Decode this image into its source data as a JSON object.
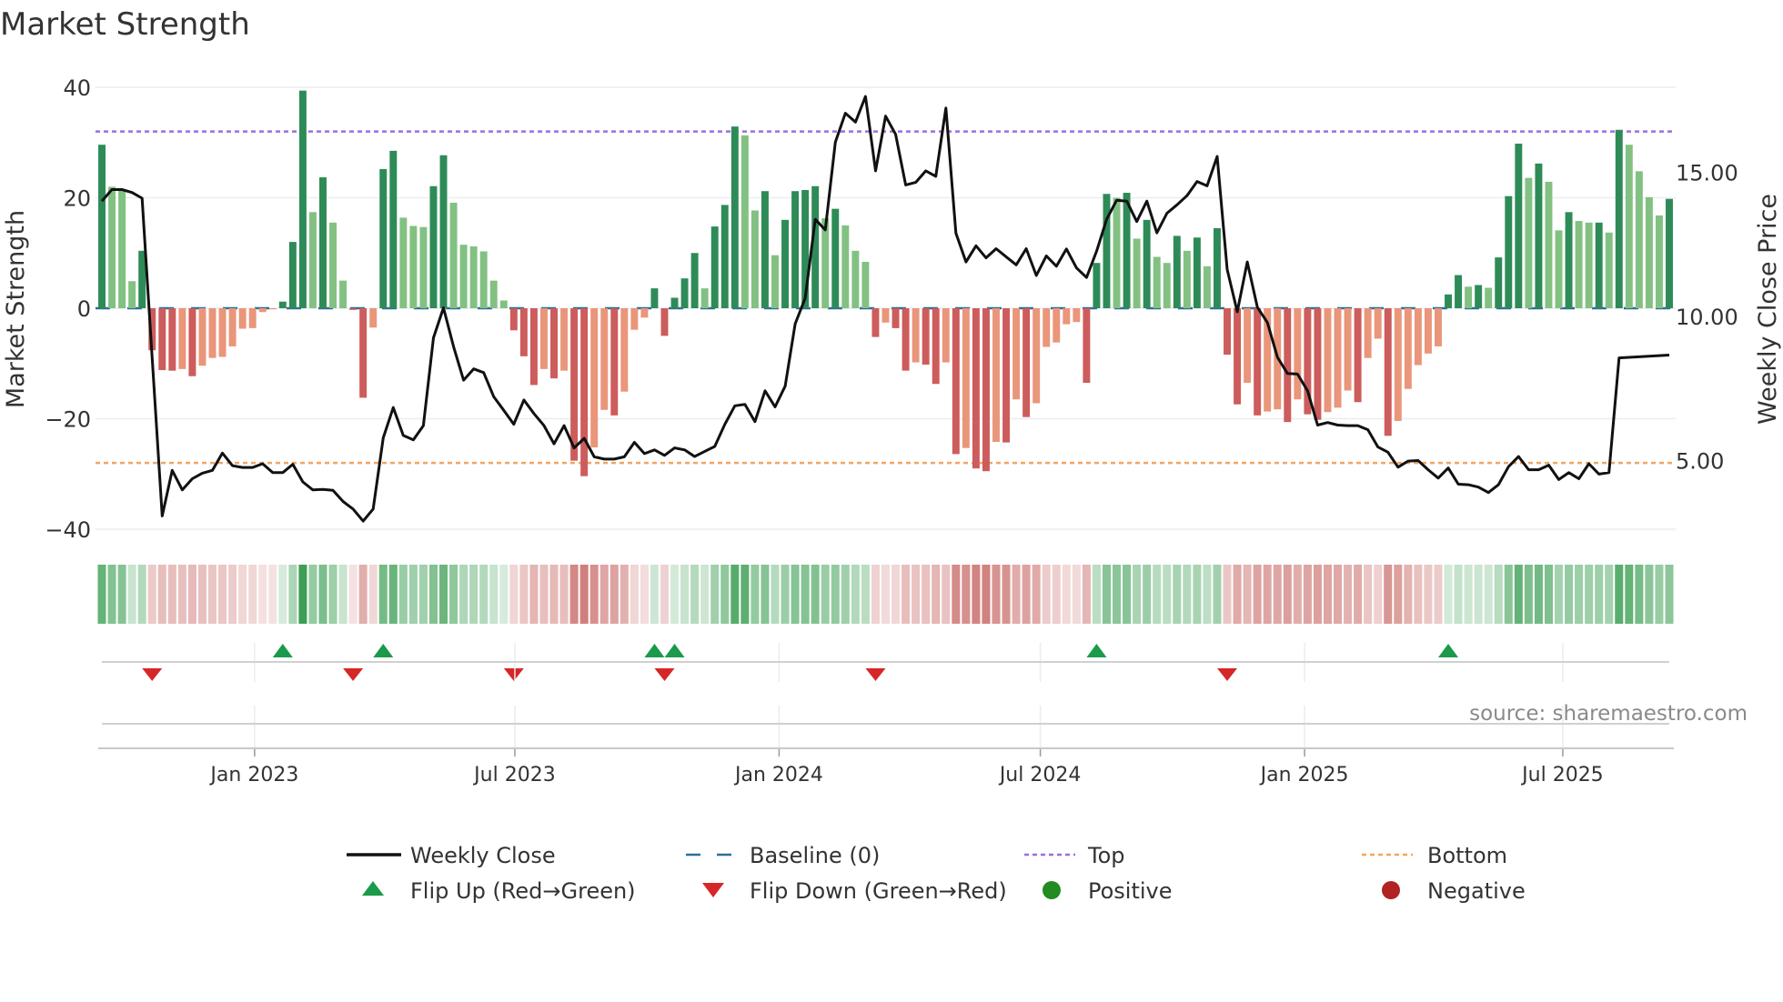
{
  "chart_data": {
    "type": "bar",
    "title": "Market Strength",
    "ylabel": "Market Strength",
    "y2label": "Weekly Close Price",
    "source": "source: sharemaestro.com",
    "ylim": [
      -42,
      42
    ],
    "yticks": [
      40,
      20,
      0,
      -20,
      -40
    ],
    "ytick_labels": [
      "40",
      "20",
      "0",
      "−20",
      "−40"
    ],
    "y2ticks": [
      5,
      10,
      15
    ],
    "y2tick_labels": [
      "5.00",
      "10.00",
      "15.00"
    ],
    "top_level": 32,
    "bottom_level": -28,
    "xticks": [
      {
        "week": 15.2,
        "label": "Jan 2023"
      },
      {
        "week": 41.1,
        "label": "Jul 2023"
      },
      {
        "week": 67.4,
        "label": "Jan 2024"
      },
      {
        "week": 93.4,
        "label": "Jul 2024"
      },
      {
        "week": 119.7,
        "label": "Jan 2025"
      },
      {
        "week": 145.4,
        "label": "Jul 2025"
      }
    ],
    "strength": [
      29.6,
      22,
      21.3,
      4.9,
      10.4,
      -7.6,
      -11.2,
      -11.3,
      -11,
      -12.3,
      -10.4,
      -9,
      -8.8,
      -6.9,
      -3.7,
      -3.6,
      -0.7,
      -0.2,
      1.2,
      12,
      39.4,
      17.4,
      23.7,
      15.5,
      5,
      -0.3,
      -16.2,
      -3.5,
      25.2,
      28.5,
      16.4,
      14.9,
      14.7,
      22.1,
      27.7,
      19.1,
      11.5,
      11.2,
      10.3,
      5,
      1.4,
      -4,
      -8.7,
      -13.9,
      -11,
      -12.7,
      -11.3,
      -27.6,
      -30.4,
      -25.2,
      -18.4,
      -19.4,
      -15.1,
      -3.9,
      -1.7,
      3.6,
      -5,
      1.9,
      5.4,
      10,
      3.6,
      14.8,
      18.7,
      32.9,
      31.3,
      17.7,
      21.2,
      9.6,
      16,
      21.2,
      21.4,
      22.1,
      16.3,
      18,
      15,
      10.4,
      8.4,
      -5.2,
      -2.6,
      -3.6,
      -11.3,
      -9.8,
      -10.2,
      -13.7,
      -9.8,
      -26.4,
      -25.3,
      -29,
      -29.5,
      -24.2,
      -24.3,
      -16.5,
      -19.7,
      -17.2,
      -7,
      -6.2,
      -2.9,
      -2.5,
      -13.5,
      8.2,
      20.7,
      20,
      20.9,
      12.6,
      16,
      9.3,
      8.2,
      13.1,
      10.4,
      12.8,
      7.6,
      14.5,
      -8.4,
      -17.4,
      -13.5,
      -19.4,
      -18.7,
      -18.3,
      -20.6,
      -16.5,
      -19.2,
      -20.2,
      -18.8,
      -18,
      -14.9,
      -17,
      -9,
      -5.5,
      -23.1,
      -20.4,
      -14.6,
      -10.3,
      -8.2,
      -6.9,
      2.5,
      6,
      3.9,
      4.2,
      3.7,
      9.2,
      20.3,
      29.8,
      23.6,
      26.2,
      22.9,
      14.1,
      17.4,
      15.8,
      15.5,
      15.5,
      13.7,
      32.3,
      29.6,
      24.8,
      20.1,
      16.8,
      19.8
    ],
    "weekly_close": [
      14.0,
      14.4,
      14.4,
      14.3,
      14.1,
      8.6,
      3.08,
      4.66,
      3.98,
      4.37,
      4.56,
      4.66,
      5.26,
      4.82,
      4.76,
      4.76,
      4.89,
      4.58,
      4.58,
      4.87,
      4.26,
      3.98,
      4.0,
      3.97,
      3.58,
      3.32,
      2.9,
      3.32,
      5.79,
      6.84,
      5.87,
      5.72,
      6.21,
      9.26,
      10.3,
      8.95,
      7.79,
      8.18,
      8.05,
      7.21,
      6.74,
      6.26,
      7.1,
      6.63,
      6.21,
      5.58,
      6.21,
      5.44,
      5.77,
      5.13,
      5.05,
      5.05,
      5.13,
      5.63,
      5.24,
      5.37,
      5.18,
      5.44,
      5.37,
      5.14,
      5.32,
      5.49,
      6.26,
      6.9,
      6.95,
      6.35,
      7.42,
      6.86,
      7.58,
      9.74,
      10.63,
      13.37,
      13.0,
      16.05,
      17.05,
      16.74,
      17.63,
      15.05,
      16.95,
      16.32,
      14.56,
      14.65,
      15.05,
      14.86,
      17.23,
      12.89,
      11.89,
      12.45,
      12.03,
      12.35,
      12.07,
      11.79,
      12.35,
      11.42,
      12.1,
      11.74,
      12.34,
      11.68,
      11.35,
      12.26,
      13.37,
      14.03,
      14.0,
      13.29,
      14.0,
      12.9,
      13.58,
      13.87,
      14.19,
      14.68,
      14.53,
      15.55,
      11.63,
      10.16,
      11.89,
      10.32,
      9.79,
      8.58,
      8.02,
      8.0,
      7.42,
      6.23,
      6.32,
      6.23,
      6.21,
      6.21,
      6.07,
      5.47,
      5.29,
      4.77,
      4.98,
      5.0,
      4.68,
      4.39,
      4.74,
      4.18,
      4.16,
      4.08,
      3.89,
      4.16,
      4.79,
      5.14,
      4.68,
      4.68,
      4.84,
      4.34,
      4.58,
      4.37,
      4.89,
      4.53,
      4.58,
      8.56,
      8.58,
      8.6,
      8.62,
      8.64,
      8.66
    ],
    "y2lim": [
      2.4,
      18.3
    ],
    "legend": {
      "placement": "bottom",
      "items": [
        {
          "key": "close",
          "label": "Weekly Close"
        },
        {
          "key": "baseline",
          "label": "Baseline (0)"
        },
        {
          "key": "top",
          "label": "Top"
        },
        {
          "key": "bottom",
          "label": "Bottom"
        },
        {
          "key": "flip_up",
          "label": "Flip Up (Red→Green)"
        },
        {
          "key": "flip_down",
          "label": "Flip Down (Green→Red)"
        },
        {
          "key": "positive",
          "label": "Positive"
        },
        {
          "key": "negative",
          "label": "Negative"
        }
      ]
    },
    "colors": {
      "pos_strong": "#2e8b57",
      "pos_weak": "#82c182",
      "neg_strong": "#cd5c5c",
      "neg_weak": "#e9967a",
      "baseline": "#2b6f99",
      "top": "#9b6ee0",
      "bottom": "#f2a65e",
      "close": "#111111",
      "flip_up": "#1a9a4a",
      "flip_down": "#d62728",
      "positive": "#228b22",
      "negative": "#b22222",
      "strip_pos": "#3a9e52",
      "strip_neg": "#c4605c"
    }
  }
}
